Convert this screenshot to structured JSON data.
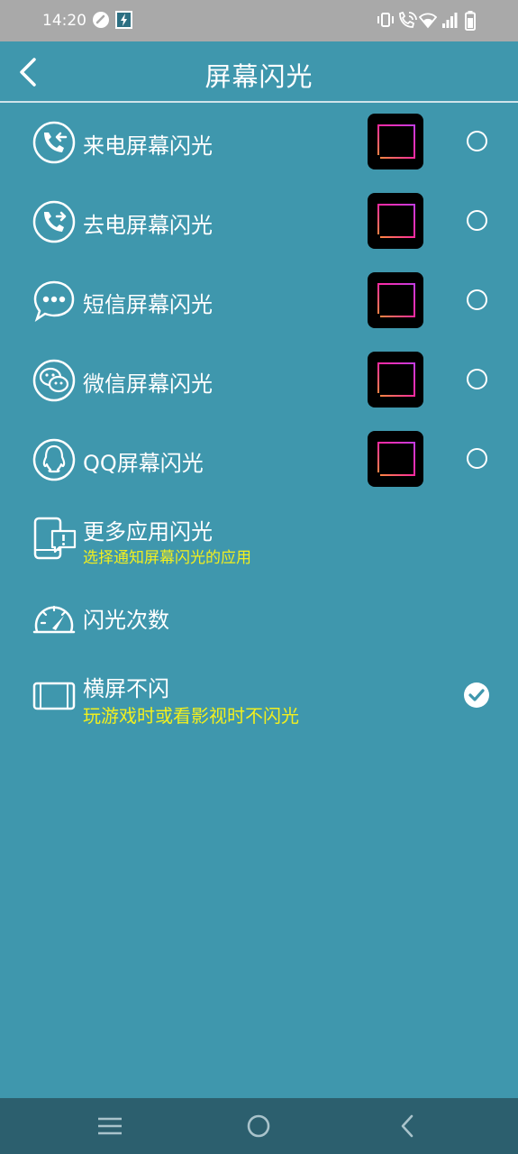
{
  "status_bar": {
    "time": "14:20",
    "icons": [
      "speed-icon",
      "flash-app-icon",
      "vibrate-icon",
      "wifi-call-icon",
      "wifi-icon",
      "signal-icon",
      "battery-icon"
    ]
  },
  "header": {
    "title": "屏幕闪光",
    "back_icon": "back-arrow-icon"
  },
  "settings": [
    {
      "label": "来电屏幕闪光",
      "icon": "incoming-call-icon",
      "selected": false
    },
    {
      "label": "去电屏幕闪光",
      "icon": "outgoing-call-icon",
      "selected": false
    },
    {
      "label": "短信屏幕闪光",
      "icon": "sms-icon",
      "selected": false
    },
    {
      "label": "微信屏幕闪光",
      "icon": "wechat-icon",
      "selected": false
    },
    {
      "label": "QQ屏幕闪光",
      "icon": "qq-icon",
      "selected": false
    },
    {
      "label": "更多应用闪光",
      "sub": "选择通知屏幕闪光的应用",
      "icon": "app-notification-icon"
    },
    {
      "label": "闪光次数",
      "icon": "speedometer-icon"
    },
    {
      "label": "横屏不闪",
      "sub": "玩游戏时或看影视时不闪光",
      "icon": "landscape-phone-icon",
      "checked": true
    }
  ],
  "nav_bar": {
    "icons": [
      "menu-icon",
      "home-icon",
      "back-icon"
    ]
  },
  "colors": {
    "background": "#3f97ad",
    "status_bar": "#a9a9a9",
    "nav_bar": "#2c5f6e",
    "subtitle": "#f2ef1e",
    "preview_gradient": [
      "#ff8a3d",
      "#ff2aa0",
      "#c23ce0"
    ]
  }
}
